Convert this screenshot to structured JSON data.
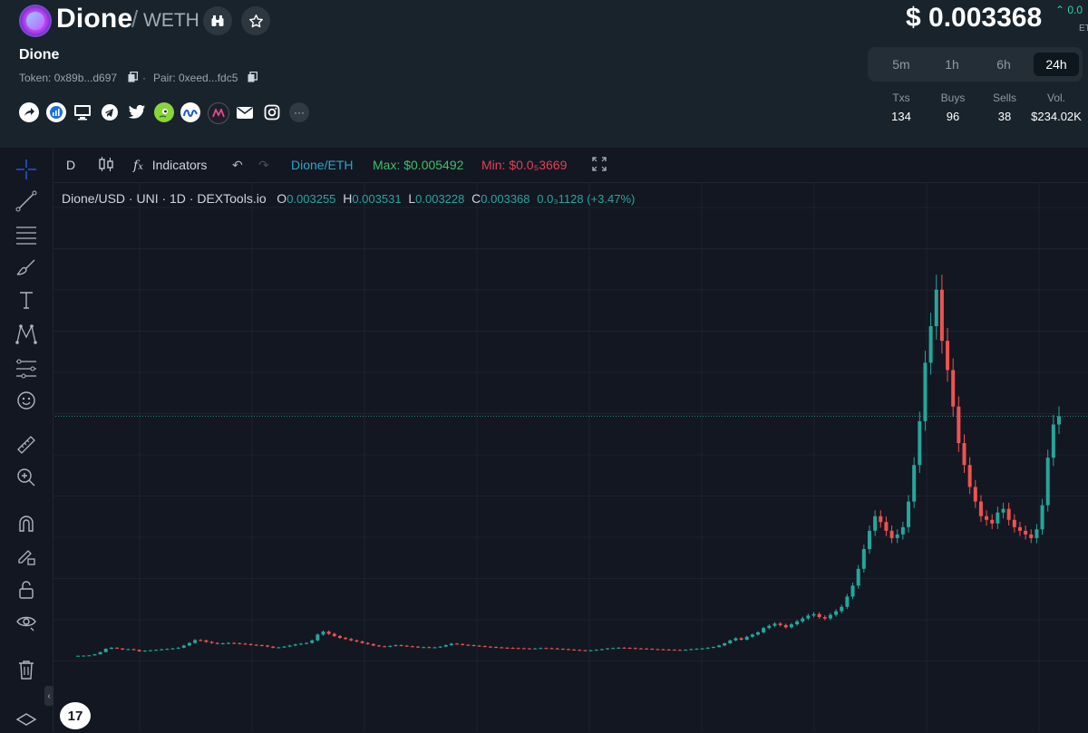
{
  "header": {
    "pair_base": "Dione",
    "pair_quote": "WETH",
    "token_name": "Dione",
    "token_label": "Token: 0x89b...d697",
    "pair_label": "Pair: 0xeed...fdc5",
    "price": "$ 0.003368",
    "price_change": "0.0",
    "price_change_unit": "ET"
  },
  "timeframes": {
    "items": [
      "5m",
      "1h",
      "6h",
      "24h"
    ],
    "active": "24h"
  },
  "stats": {
    "txs_label": "Txs",
    "txs": "134",
    "buys_label": "Buys",
    "buys": "96",
    "sells_label": "Sells",
    "sells": "38",
    "vol_label": "Vol.",
    "vol": "$234.02K"
  },
  "chart_toolbar": {
    "interval": "D",
    "indicators": "Indicators",
    "pair": "Dione/ETH",
    "max": "Max: $0.005492",
    "min": "Min: $0.0₅3669"
  },
  "ohlc": {
    "symbol": "Dione/USD · UNI · 1D · DEXTools.io",
    "o_label": "O",
    "o": "0.003255",
    "h_label": "H",
    "h": "0.003531",
    "l_label": "L",
    "l": "0.003228",
    "c_label": "C",
    "c": "0.003368",
    "change": "0.0₃1128 (+3.47%)"
  },
  "colors": {
    "up": "#26a69a",
    "down": "#ef5350",
    "accent": "#2fd1a3",
    "pair_link": "#2aa6c9",
    "min_red": "#e04055",
    "max_green": "#3fbf6a"
  },
  "chart_data": {
    "type": "candlestick",
    "y_unit": "USD",
    "series": [
      {
        "name": "Dione/USD",
        "close": [
          9e-05,
          9.2e-05,
          9.5e-05,
          0.00011,
          0.00014,
          0.000185,
          0.0002,
          0.00019,
          0.000175,
          0.00018,
          0.00017,
          0.00015,
          0.00016,
          0.000165,
          0.00017,
          0.000178,
          0.000183,
          0.00019,
          0.0002,
          0.00023,
          0.000265,
          0.000305,
          0.0003,
          0.00028,
          0.000265,
          0.000255,
          0.00026,
          0.000265,
          0.000262,
          0.000255,
          0.00025,
          0.00024,
          0.000235,
          0.00023,
          0.000215,
          0.0002,
          0.000205,
          0.000215,
          0.00023,
          0.000245,
          0.000255,
          0.000265,
          0.0003,
          0.00038,
          0.00042,
          0.00039,
          0.00036,
          0.000335,
          0.00032,
          0.0003,
          0.000285,
          0.000265,
          0.00025,
          0.00023,
          0.00022,
          0.000215,
          0.000225,
          0.000235,
          0.000228,
          0.00022,
          0.000215,
          0.000205,
          0.000208,
          0.0002,
          0.000205,
          0.000215,
          0.000235,
          0.000255,
          0.00025,
          0.00024,
          0.000235,
          0.000228,
          0.000222,
          0.000215,
          0.00021,
          0.000205,
          0.0002,
          0.000198,
          0.000195,
          0.000193,
          0.00019,
          0.000188,
          0.00019,
          0.000195,
          0.000193,
          0.00019,
          0.000185,
          0.00018,
          0.000175,
          0.00017,
          0.000165,
          0.00016,
          0.000165,
          0.000172,
          0.00018,
          0.00019,
          0.000195,
          0.0002,
          0.000198,
          0.000195,
          0.00019,
          0.000188,
          0.000185,
          0.00018,
          0.000178,
          0.000175,
          0.000172,
          0.00017,
          0.000168,
          0.000172,
          0.00018,
          0.000185,
          0.00019,
          0.0002,
          0.00021,
          0.00023,
          0.00026,
          0.0003,
          0.00033,
          0.00031,
          0.00035,
          0.00038,
          0.00041,
          0.00047,
          0.0005,
          0.00053,
          0.00051,
          0.00048,
          0.00052,
          0.00056,
          0.0006,
          0.00064,
          0.00066,
          0.00062,
          0.0006,
          0.00065,
          0.0007,
          0.00076,
          0.0009,
          0.00105,
          0.00128,
          0.00155,
          0.0018,
          0.002,
          0.00192,
          0.0018,
          0.0017,
          0.00175,
          0.00185,
          0.0022,
          0.0027,
          0.0033,
          0.0041,
          0.0046,
          0.0051,
          0.0044,
          0.004,
          0.0035,
          0.003,
          0.0027,
          0.0024,
          0.0022,
          0.002,
          0.00195,
          0.0019,
          0.00205,
          0.0021,
          0.00195,
          0.00185,
          0.0018,
          0.00175,
          0.0017,
          0.00182,
          0.00215,
          0.0028,
          0.003255,
          0.003368
        ]
      }
    ],
    "ylim": [
      0,
      0.0062
    ],
    "last_price": 0.003368,
    "max": 0.005492,
    "grid": true
  }
}
